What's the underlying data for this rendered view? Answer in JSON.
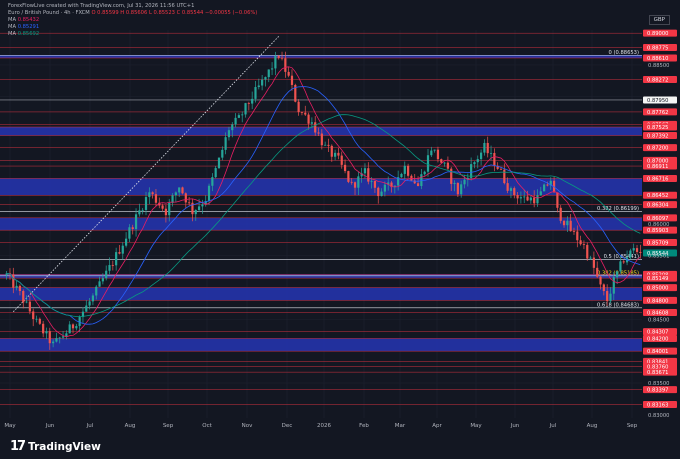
{
  "header": {
    "title": "Euro / British Pound · 4h · FXCM",
    "o": "O 0.85599",
    "h": "H 0.85606",
    "l": "L 0.85523",
    "c": "C 0.85544",
    "chg": "−0.00055 (−0.06%)",
    "credit": "ForexFlowLive created with TradingView.com, Jul 31, 2026 11:56 UTC+1",
    "ma1": "0.85432",
    "ma2": "0.85291",
    "ma3": "0.85692",
    "ma_label": "MA"
  },
  "currency": "GBP",
  "brand": {
    "logo": "17",
    "name": "TradingView"
  },
  "colors": {
    "bg": "#131722",
    "grid": "#1f2330",
    "up": "#26a69a",
    "down": "#ef5350",
    "zone": "#2433a8",
    "resistance": "#f23645",
    "white": "#e0e3eb",
    "ma1": "#e91e63",
    "ma2": "#2962ff",
    "ma3": "#089981",
    "fib": "#e0e3eb"
  },
  "chart_data": {
    "type": "candlestick",
    "symbol": "EURGBP",
    "timeframe": "4h",
    "currency": "GBP",
    "ylim": [
      0.8295,
      0.8905
    ],
    "x_ticks": [
      "May",
      "Jun",
      "Jul",
      "Aug",
      "Sep",
      "Oct",
      "Nov",
      "Dec",
      "2026",
      "Feb",
      "Mar",
      "Apr",
      "May",
      "Jun",
      "Jul",
      "Aug",
      "Sep"
    ],
    "y_labels": [
      {
        "v": 0.89,
        "kind": "red",
        "text": "0.89000"
      },
      {
        "v": 0.88775,
        "kind": "red",
        "text": "0.88775"
      },
      {
        "v": 0.8861,
        "kind": "red",
        "text": "0.88610"
      },
      {
        "v": 0.885,
        "kind": "grey",
        "text": "0.88500"
      },
      {
        "v": 0.88272,
        "kind": "red",
        "text": "0.88272"
      },
      {
        "v": 0.8795,
        "kind": "white",
        "text": "0.87950"
      },
      {
        "v": 0.87762,
        "kind": "red",
        "text": "0.87762"
      },
      {
        "v": 0.87567,
        "kind": "red",
        "text": "0.87567"
      },
      {
        "v": 0.87525,
        "kind": "red",
        "text": "0.87525"
      },
      {
        "v": 0.87392,
        "kind": "red",
        "text": "0.87392"
      },
      {
        "v": 0.872,
        "kind": "red",
        "text": "0.87200"
      },
      {
        "v": 0.86911,
        "kind": "red",
        "text": "0.86911"
      },
      {
        "v": 0.87,
        "kind": "red",
        "text": "0.87000"
      },
      {
        "v": 0.86716,
        "kind": "red",
        "text": "0.86716"
      },
      {
        "v": 0.86452,
        "kind": "red",
        "text": "0.86452"
      },
      {
        "v": 0.86304,
        "kind": "red",
        "text": "0.86304"
      },
      {
        "v": 0.86097,
        "kind": "red",
        "text": "0.86097"
      },
      {
        "v": 0.86,
        "kind": "grey",
        "text": "0.86000"
      },
      {
        "v": 0.85903,
        "kind": "red",
        "text": "0.85903"
      },
      {
        "v": 0.85709,
        "kind": "red",
        "text": "0.85709"
      },
      {
        "v": 0.85544,
        "kind": "price",
        "text": "0.85544"
      },
      {
        "v": 0.85501,
        "kind": "grey",
        "text": "0.85501"
      },
      {
        "v": 0.85208,
        "kind": "red",
        "text": "0.85208"
      },
      {
        "v": 0.85149,
        "kind": "red",
        "text": "0.85149"
      },
      {
        "v": 0.85,
        "kind": "red",
        "text": "0.85000"
      },
      {
        "v": 0.848,
        "kind": "red",
        "text": "0.84800"
      },
      {
        "v": 0.84608,
        "kind": "red",
        "text": "0.84608"
      },
      {
        "v": 0.845,
        "kind": "grey",
        "text": "0.84500"
      },
      {
        "v": 0.84307,
        "kind": "red",
        "text": "0.84307"
      },
      {
        "v": 0.842,
        "kind": "red",
        "text": "0.84200"
      },
      {
        "v": 0.84001,
        "kind": "red",
        "text": "0.84001"
      },
      {
        "v": 0.83841,
        "kind": "red",
        "text": "0.83841"
      },
      {
        "v": 0.8376,
        "kind": "red",
        "text": "0.83760"
      },
      {
        "v": 0.83671,
        "kind": "red",
        "text": "0.83671"
      },
      {
        "v": 0.835,
        "kind": "grey",
        "text": "0.83500"
      },
      {
        "v": 0.83397,
        "kind": "red",
        "text": "0.83397"
      },
      {
        "v": 0.83163,
        "kind": "red",
        "text": "0.83163"
      },
      {
        "v": 0.83,
        "kind": "grey",
        "text": "0.83000"
      }
    ],
    "zones": [
      {
        "from": 0.8861,
        "to": 0.88655
      },
      {
        "from": 0.87392,
        "to": 0.87525
      },
      {
        "from": 0.86452,
        "to": 0.86716
      },
      {
        "from": 0.85903,
        "to": 0.86097
      },
      {
        "from": 0.848,
        "to": 0.85
      },
      {
        "from": 0.85149,
        "to": 0.85208
      },
      {
        "from": 0.84001,
        "to": 0.842
      }
    ],
    "fib_labels": [
      {
        "v": 0.88653,
        "text": "0 (0.88653)"
      },
      {
        "v": 0.86199,
        "text": "0.382 (0.86199)"
      },
      {
        "v": 0.85441,
        "text": "0.5 (0.85441)"
      },
      {
        "v": 0.85185,
        "text": "0.382 (0.85185)",
        "yellow": true
      },
      {
        "v": 0.84683,
        "text": "0.618 (0.84683)"
      }
    ],
    "waypoints": [
      [
        0,
        0.852
      ],
      [
        4,
        0.849
      ],
      [
        9,
        0.8445
      ],
      [
        14,
        0.841
      ],
      [
        20,
        0.844
      ],
      [
        26,
        0.8485
      ],
      [
        32,
        0.854
      ],
      [
        38,
        0.86
      ],
      [
        43,
        0.865
      ],
      [
        48,
        0.862
      ],
      [
        52,
        0.866
      ],
      [
        56,
        0.862
      ],
      [
        60,
        0.864
      ],
      [
        64,
        0.87
      ],
      [
        67,
        0.875
      ],
      [
        70,
        0.8765
      ],
      [
        74,
        0.88
      ],
      [
        78,
        0.883
      ],
      [
        82,
        0.8866
      ],
      [
        85,
        0.883
      ],
      [
        88,
        0.878
      ],
      [
        92,
        0.876
      ],
      [
        96,
        0.872
      ],
      [
        100,
        0.87
      ],
      [
        104,
        0.866
      ],
      [
        108,
        0.868
      ],
      [
        112,
        0.865
      ],
      [
        116,
        0.866
      ],
      [
        120,
        0.869
      ],
      [
        124,
        0.866
      ],
      [
        128,
        0.872
      ],
      [
        132,
        0.869
      ],
      [
        136,
        0.865
      ],
      [
        140,
        0.869
      ],
      [
        144,
        0.872
      ],
      [
        148,
        0.869
      ],
      [
        152,
        0.865
      ],
      [
        156,
        0.864
      ],
      [
        160,
        0.864
      ],
      [
        164,
        0.867
      ],
      [
        166,
        0.862
      ],
      [
        170,
        0.859
      ],
      [
        174,
        0.8565
      ],
      [
        177,
        0.853
      ],
      [
        179,
        0.85
      ],
      [
        181,
        0.848
      ],
      [
        183,
        0.851
      ],
      [
        186,
        0.8545
      ],
      [
        189,
        0.856
      ],
      [
        191,
        0.8554
      ]
    ]
  }
}
